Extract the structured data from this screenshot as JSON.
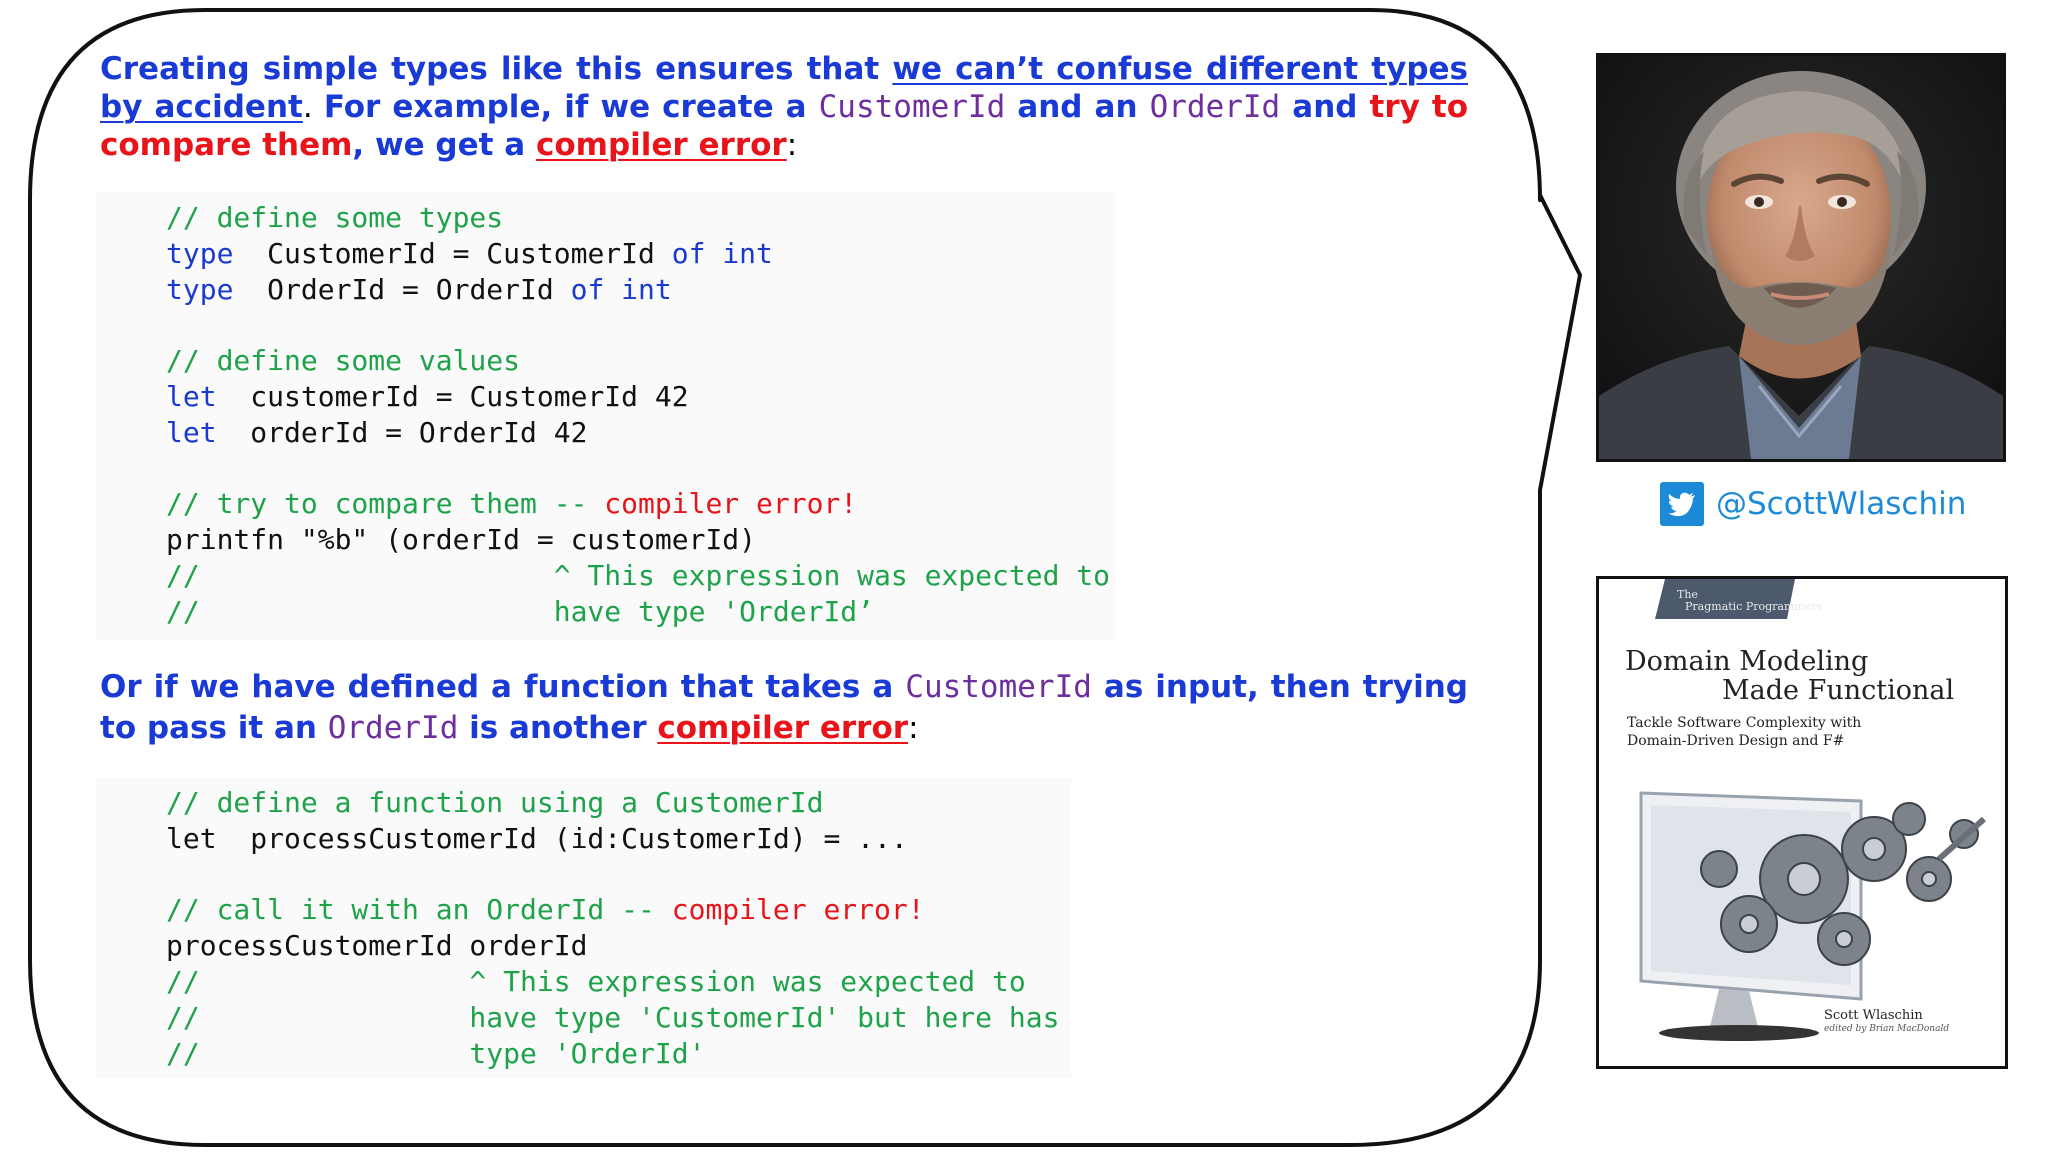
{
  "colors": {
    "body_text": "#1a3ad6",
    "highlight_red": "#e8141a",
    "type_name_purple": "#6d2f9e",
    "code_comment": "#1ea24a",
    "code_keyword": "#1939cf",
    "twitter_blue": "#1d8ad7"
  },
  "paragraph1": [
    {
      "text": "Creating simple types like this ensures that ",
      "style": "plain"
    },
    {
      "text": "we can’t confuse different types by accident",
      "style": "underline"
    },
    {
      "text": ". ",
      "style": "black"
    },
    {
      "text": "For example, if we create a ",
      "style": "plain"
    },
    {
      "text": "CustomerId",
      "style": "purple"
    },
    {
      "text": " and an ",
      "style": "plain"
    },
    {
      "text": "OrderId",
      "style": "purple"
    },
    {
      "text": " and ",
      "style": "plain"
    },
    {
      "text": "try to compare them",
      "style": "red"
    },
    {
      "text": ", we get a ",
      "style": "plain"
    },
    {
      "text": "compiler error",
      "style": "red-underline"
    },
    {
      "text": ":",
      "style": "black"
    }
  ],
  "code_block1": [
    [
      {
        "text": "// define some types",
        "style": "comment"
      }
    ],
    [
      {
        "text": "type",
        "style": "keyword"
      },
      {
        "text": "  CustomerId = CustomerId ",
        "style": "plain"
      },
      {
        "text": "of",
        "style": "keyword"
      },
      {
        "text": " ",
        "style": "plain"
      },
      {
        "text": "int",
        "style": "keyword"
      }
    ],
    [
      {
        "text": "type",
        "style": "keyword"
      },
      {
        "text": "  OrderId = OrderId ",
        "style": "plain"
      },
      {
        "text": "of",
        "style": "keyword"
      },
      {
        "text": " ",
        "style": "plain"
      },
      {
        "text": "int",
        "style": "keyword"
      }
    ],
    [],
    [
      {
        "text": "// define some values",
        "style": "comment"
      }
    ],
    [
      {
        "text": "let",
        "style": "keyword"
      },
      {
        "text": "  customerId = CustomerId 42",
        "style": "plain"
      }
    ],
    [
      {
        "text": "let",
        "style": "keyword"
      },
      {
        "text": "  orderId = OrderId 42",
        "style": "plain"
      }
    ],
    [],
    [
      {
        "text": "// try to compare them -- ",
        "style": "comment"
      },
      {
        "text": "compiler error!",
        "style": "error"
      }
    ],
    [
      {
        "text": "printfn \"%b\" (orderId = customerId)",
        "style": "plain"
      }
    ],
    [
      {
        "text": "//                     ^ This expression was expected to",
        "style": "comment"
      }
    ],
    [
      {
        "text": "//                     have type 'OrderId’",
        "style": "comment"
      }
    ]
  ],
  "paragraph2": [
    {
      "text": "Or if we have defined a function that takes a ",
      "style": "plain"
    },
    {
      "text": "CustomerId",
      "style": "purple"
    },
    {
      "text": " as input, then trying to pass it an ",
      "style": "plain"
    },
    {
      "text": "OrderId",
      "style": "purple"
    },
    {
      "text": " is another ",
      "style": "plain"
    },
    {
      "text": "compiler error",
      "style": "red-underline"
    },
    {
      "text": ":",
      "style": "black"
    }
  ],
  "code_block2": [
    [
      {
        "text": "// define a function using a CustomerId",
        "style": "comment"
      }
    ],
    [
      {
        "text": "let  processCustomerId (id:CustomerId) = ...",
        "style": "plain"
      }
    ],
    [],
    [
      {
        "text": "// call it with an OrderId -- ",
        "style": "comment"
      },
      {
        "text": "compiler error!",
        "style": "error"
      }
    ],
    [
      {
        "text": "processCustomerId orderId",
        "style": "plain"
      }
    ],
    [
      {
        "text": "//                ^ This expression was expected to",
        "style": "comment"
      }
    ],
    [
      {
        "text": "//                have type 'CustomerId' but here has",
        "style": "comment"
      }
    ],
    [
      {
        "text": "//                type 'OrderId'",
        "style": "comment"
      }
    ]
  ],
  "sidebar": {
    "twitter_handle": "@ScottWlaschin",
    "twitter_icon": "twitter-bird-icon"
  },
  "book": {
    "publisher_line1": "The",
    "publisher_line2": "Pragmatic Programmers",
    "title_line1": "Domain Modeling",
    "title_line2": "Made Functional",
    "subtitle_line1": "Tackle Software Complexity with",
    "subtitle_line2": "Domain-Driven Design and F#",
    "author": "Scott Wlaschin",
    "editor": "edited by Brian MacDonald"
  }
}
